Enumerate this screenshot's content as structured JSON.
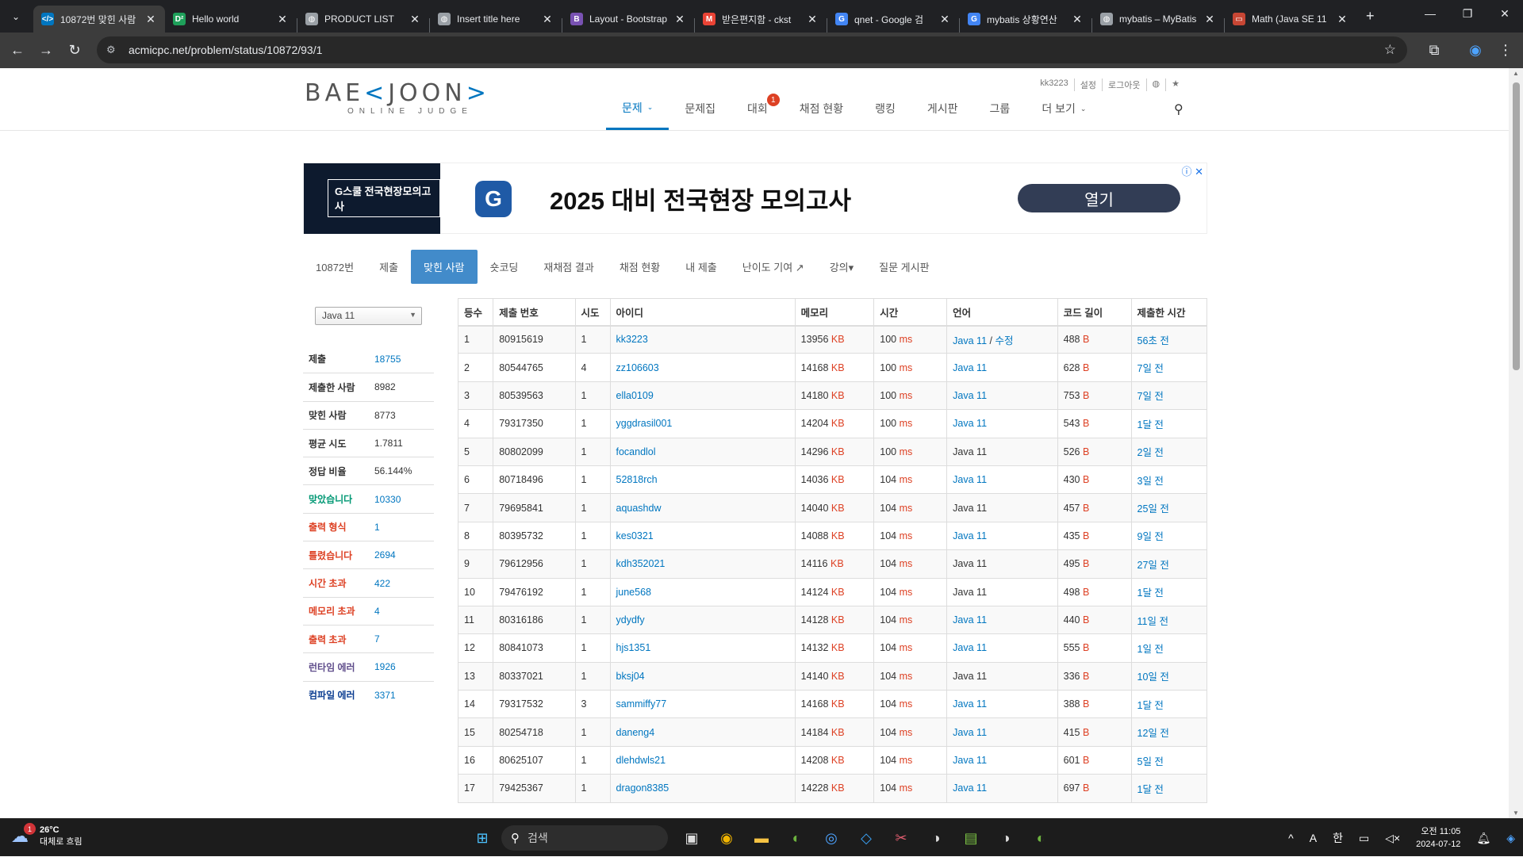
{
  "browser": {
    "tabs": [
      {
        "title": "10872번 맞힌 사람",
        "favicon": "baekjoon-icon",
        "color": "#0076c0",
        "glyph": "</>",
        "active": true
      },
      {
        "title": "Hello world",
        "favicon": "d2-icon",
        "color": "#1ea05a",
        "glyph": "D²",
        "active": false
      },
      {
        "title": "PRODUCT LIST",
        "favicon": "globe-icon",
        "color": "#9aa0a6",
        "glyph": "◍",
        "active": false
      },
      {
        "title": "Insert title here",
        "favicon": "globe-icon",
        "color": "#9aa0a6",
        "glyph": "◍",
        "active": false
      },
      {
        "title": "Layout - Bootstrap",
        "favicon": "bootstrap-icon",
        "color": "#7952b3",
        "glyph": "B",
        "active": false
      },
      {
        "title": "받은편지함 - ckst",
        "favicon": "gmail-icon",
        "color": "#ea4335",
        "glyph": "M",
        "active": false
      },
      {
        "title": "qnet - Google 검",
        "favicon": "google-icon",
        "color": "#4285f4",
        "glyph": "G",
        "active": false
      },
      {
        "title": "mybatis 상황연산",
        "favicon": "google-icon",
        "color": "#4285f4",
        "glyph": "G",
        "active": false
      },
      {
        "title": "mybatis – MyBatis",
        "favicon": "globe-icon",
        "color": "#9aa0a6",
        "glyph": "◍",
        "active": false
      },
      {
        "title": "Math (Java SE 11",
        "favicon": "oracle-icon",
        "color": "#c74634",
        "glyph": "▭",
        "active": false
      }
    ],
    "url": "acmicpc.net/problem/status/10872/93/1"
  },
  "site": {
    "logo_main": "BAE",
    "logo_bracket_left": "<",
    "logo_main2": "JOON",
    "logo_bracket_right": ">",
    "logo_sub": "ONLINE JUDGE",
    "user_menu": [
      "kk3223",
      "설정",
      "로그아웃",
      "◍",
      "★"
    ],
    "nav": [
      {
        "label": "문제",
        "caret": true,
        "active": true
      },
      {
        "label": "문제집",
        "caret": false,
        "active": false
      },
      {
        "label": "대회",
        "caret": false,
        "active": false,
        "badge": "1"
      },
      {
        "label": "채점 현황",
        "caret": false,
        "active": false
      },
      {
        "label": "랭킹",
        "caret": false,
        "active": false
      },
      {
        "label": "게시판",
        "caret": false,
        "active": false
      },
      {
        "label": "그룹",
        "caret": false,
        "active": false
      },
      {
        "label": "더 보기",
        "caret": true,
        "active": false
      }
    ]
  },
  "ad": {
    "thumb_text": "G스쿨 전국현장모의고사",
    "logo_letter": "G",
    "headline": "2025 대비 전국현장 모의고사",
    "button": "열기",
    "info": "ⓘ ✕"
  },
  "problem_menu": [
    {
      "label": "10872번",
      "active": false
    },
    {
      "label": "제출",
      "active": false
    },
    {
      "label": "맞힌 사람",
      "active": true
    },
    {
      "label": "숏코딩",
      "active": false
    },
    {
      "label": "재채점 결과",
      "active": false
    },
    {
      "label": "채점 현황",
      "active": false
    },
    {
      "label": "내 제출",
      "active": false
    },
    {
      "label": "난이도 기여 ↗",
      "active": false
    },
    {
      "label": "강의▾",
      "active": false
    },
    {
      "label": "질문 게시판",
      "active": false
    }
  ],
  "language_select": "Java 11",
  "stats": [
    {
      "label": "제출",
      "value": "18755",
      "label_class": "",
      "value_class": "blue"
    },
    {
      "label": "제출한 사람",
      "value": "8982",
      "label_class": "",
      "value_class": ""
    },
    {
      "label": "맞힌 사람",
      "value": "8773",
      "label_class": "",
      "value_class": ""
    },
    {
      "label": "평균 시도",
      "value": "1.7811",
      "label_class": "",
      "value_class": ""
    },
    {
      "label": "정답 비율",
      "value": "56.144%",
      "label_class": "",
      "value_class": ""
    },
    {
      "label": "맞았습니다",
      "value": "10330",
      "label_class": "green",
      "value_class": "blue"
    },
    {
      "label": "출력 형식",
      "value": "1",
      "label_class": "red",
      "value_class": "blue"
    },
    {
      "label": "틀렸습니다",
      "value": "2694",
      "label_class": "red",
      "value_class": "blue"
    },
    {
      "label": "시간 초과",
      "value": "422",
      "label_class": "red",
      "value_class": "blue"
    },
    {
      "label": "메모리 초과",
      "value": "4",
      "label_class": "red",
      "value_class": "blue"
    },
    {
      "label": "출력 초과",
      "value": "7",
      "label_class": "red",
      "value_class": "blue"
    },
    {
      "label": "런타임 에러",
      "value": "1926",
      "label_class": "purple",
      "value_class": "blue"
    },
    {
      "label": "컴파일 에러",
      "value": "3371",
      "label_class": "navy",
      "value_class": "blue"
    }
  ],
  "table": {
    "headers": [
      "등수",
      "제출 번호",
      "시도",
      "아이디",
      "메모리",
      "시간",
      "언어",
      "코드 길이",
      "제출한 시간"
    ],
    "units": {
      "memory": "KB",
      "time": "ms",
      "length": "B"
    },
    "rows": [
      {
        "rank": "1",
        "sub": "80915619",
        "try": "1",
        "id": "kk3223",
        "mem": "13956",
        "time": "100",
        "lang": "Java 11",
        "lang_link": true,
        "edit": "수정",
        "len": "488",
        "ago": "56초 전"
      },
      {
        "rank": "2",
        "sub": "80544765",
        "try": "4",
        "id": "zz106603",
        "mem": "14168",
        "time": "100",
        "lang": "Java 11",
        "lang_link": true,
        "len": "628",
        "ago": "7일 전"
      },
      {
        "rank": "3",
        "sub": "80539563",
        "try": "1",
        "id": "ella0109",
        "mem": "14180",
        "time": "100",
        "lang": "Java 11",
        "lang_link": true,
        "len": "753",
        "ago": "7일 전"
      },
      {
        "rank": "4",
        "sub": "79317350",
        "try": "1",
        "id": "yggdrasil001",
        "mem": "14204",
        "time": "100",
        "lang": "Java 11",
        "lang_link": true,
        "len": "543",
        "ago": "1달 전"
      },
      {
        "rank": "5",
        "sub": "80802099",
        "try": "1",
        "id": "focandlol",
        "mem": "14296",
        "time": "100",
        "lang": "Java 11",
        "lang_link": false,
        "len": "526",
        "ago": "2일 전"
      },
      {
        "rank": "6",
        "sub": "80718496",
        "try": "1",
        "id": "52818rch",
        "mem": "14036",
        "time": "104",
        "lang": "Java 11",
        "lang_link": true,
        "len": "430",
        "ago": "3일 전"
      },
      {
        "rank": "7",
        "sub": "79695841",
        "try": "1",
        "id": "aquashdw",
        "mem": "14040",
        "time": "104",
        "lang": "Java 11",
        "lang_link": false,
        "len": "457",
        "ago": "25일 전"
      },
      {
        "rank": "8",
        "sub": "80395732",
        "try": "1",
        "id": "kes0321",
        "mem": "14088",
        "time": "104",
        "lang": "Java 11",
        "lang_link": true,
        "len": "435",
        "ago": "9일 전"
      },
      {
        "rank": "9",
        "sub": "79612956",
        "try": "1",
        "id": "kdh352021",
        "mem": "14116",
        "time": "104",
        "lang": "Java 11",
        "lang_link": false,
        "len": "495",
        "ago": "27일 전"
      },
      {
        "rank": "10",
        "sub": "79476192",
        "try": "1",
        "id": "june568",
        "mem": "14124",
        "time": "104",
        "lang": "Java 11",
        "lang_link": false,
        "len": "498",
        "ago": "1달 전"
      },
      {
        "rank": "11",
        "sub": "80316186",
        "try": "1",
        "id": "ydydfy",
        "mem": "14128",
        "time": "104",
        "lang": "Java 11",
        "lang_link": true,
        "len": "440",
        "ago": "11일 전"
      },
      {
        "rank": "12",
        "sub": "80841073",
        "try": "1",
        "id": "hjs1351",
        "mem": "14132",
        "time": "104",
        "lang": "Java 11",
        "lang_link": true,
        "len": "555",
        "ago": "1일 전"
      },
      {
        "rank": "13",
        "sub": "80337021",
        "try": "1",
        "id": "bksj04",
        "mem": "14140",
        "time": "104",
        "lang": "Java 11",
        "lang_link": false,
        "len": "336",
        "ago": "10일 전"
      },
      {
        "rank": "14",
        "sub": "79317532",
        "try": "3",
        "id": "sammiffy77",
        "mem": "14168",
        "time": "104",
        "lang": "Java 11",
        "lang_link": true,
        "len": "388",
        "ago": "1달 전"
      },
      {
        "rank": "15",
        "sub": "80254718",
        "try": "1",
        "id": "daneng4",
        "mem": "14184",
        "time": "104",
        "lang": "Java 11",
        "lang_link": true,
        "len": "415",
        "ago": "12일 전"
      },
      {
        "rank": "16",
        "sub": "80625107",
        "try": "1",
        "id": "dlehdwls21",
        "mem": "14208",
        "time": "104",
        "lang": "Java 11",
        "lang_link": true,
        "len": "601",
        "ago": "5일 전"
      },
      {
        "rank": "17",
        "sub": "79425367",
        "try": "1",
        "id": "dragon8385",
        "mem": "14228",
        "time": "104",
        "lang": "Java 11",
        "lang_link": true,
        "len": "697",
        "ago": "1달 전"
      }
    ]
  },
  "taskbar": {
    "temp": "26°C",
    "weather": "대체로 흐림",
    "weather_badge": "1",
    "search": "검색",
    "apps": [
      {
        "name": "start-icon",
        "glyph": "⊞",
        "color": "#4cc2ff"
      },
      {
        "name": "task-view-icon",
        "glyph": "▣",
        "color": "#ddd"
      },
      {
        "name": "chrome-icon",
        "glyph": "◉",
        "color": "#f2b500"
      },
      {
        "name": "file-explorer-icon",
        "glyph": "▬",
        "color": "#f6c343"
      },
      {
        "name": "spring-tool-icon",
        "glyph": "◐",
        "color": "#6db33f"
      },
      {
        "name": "idea-bulb-icon",
        "glyph": "◎",
        "color": "#4da3ff"
      },
      {
        "name": "vscode-icon",
        "glyph": "◇",
        "color": "#3aa0f2"
      },
      {
        "name": "snipping-tool-icon",
        "glyph": "✂",
        "color": "#e05d6f"
      },
      {
        "name": "eclipse-icon",
        "glyph": "◑",
        "color": "#ddd"
      },
      {
        "name": "notepad-icon",
        "glyph": "▤",
        "color": "#7ac143"
      },
      {
        "name": "eclipse2-icon",
        "glyph": "◑",
        "color": "#ddd"
      },
      {
        "name": "spring-tool2-icon",
        "glyph": "◐",
        "color": "#6db33f"
      }
    ],
    "tray": [
      "^",
      "A",
      "한"
    ],
    "time": "오전 11:05",
    "date": "2024-07-12"
  }
}
